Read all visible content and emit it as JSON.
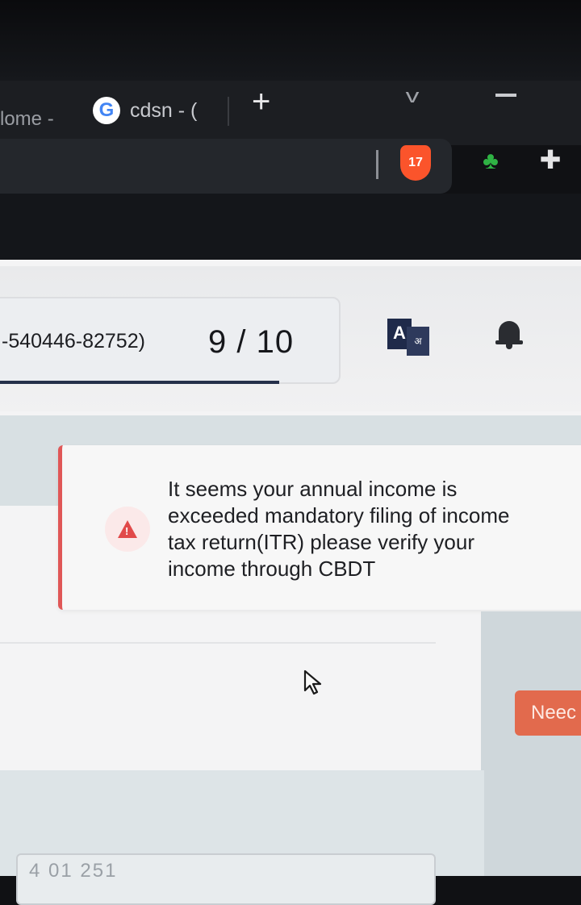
{
  "browser": {
    "tabs": [
      {
        "label": "lome -"
      },
      {
        "label": "cdsn - ("
      }
    ],
    "new_tab_symbol": "+",
    "tab_search_symbol": "v",
    "google_letter": "G",
    "brave_badge": "17"
  },
  "header": {
    "application_number": "-540446-82752)",
    "pager": "9 / 10",
    "translate_icon": {
      "a": "A",
      "b": "अ"
    }
  },
  "alert": {
    "icon_glyph": "!",
    "message": "It seems your annual income is exceeded mandatory filing of income tax return(ITR) please verify your income through CBDT",
    "accent_color": "#e05757"
  },
  "actions": {
    "need_help_label": "Neec"
  },
  "footer": {
    "partial_value": "4 01 251"
  }
}
